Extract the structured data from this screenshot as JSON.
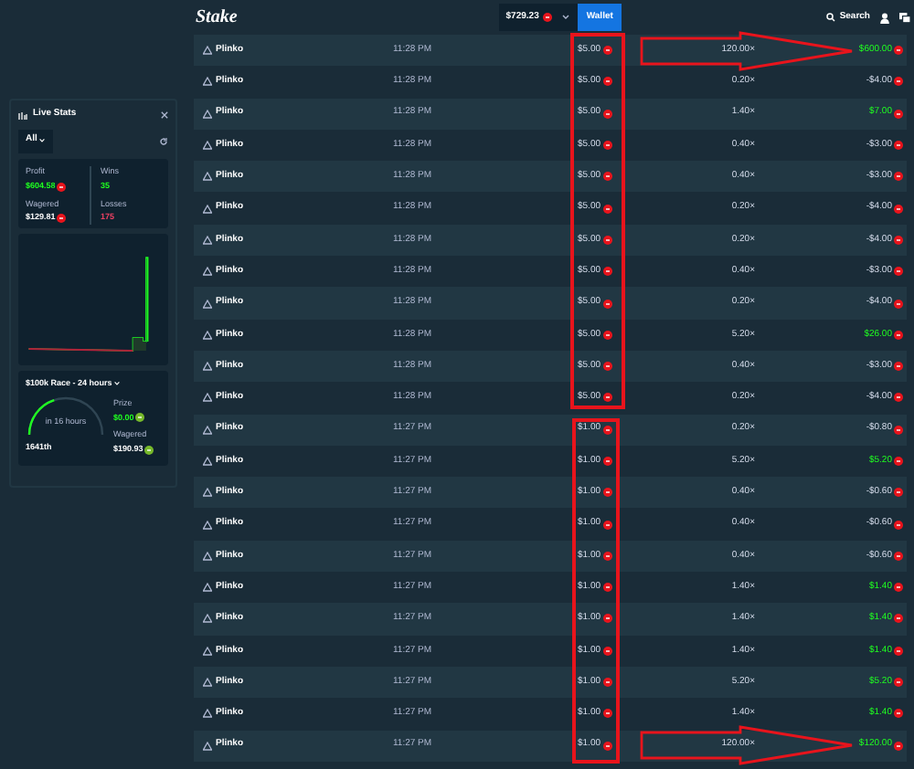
{
  "header": {
    "logo": "Stake",
    "balance": "$729.23",
    "wallet_button": "Wallet",
    "search": "Search"
  },
  "live_stats": {
    "title": "Live Stats",
    "filter": "All",
    "profit_label": "Profit",
    "profit": "$604.58",
    "wins_label": "Wins",
    "wins": "35",
    "wagered_label": "Wagered",
    "wagered": "$129.81",
    "losses_label": "Losses",
    "losses": "175",
    "race": {
      "title": "$100k Race - 24 hours",
      "timer": "in 16 hours",
      "rank": "1641th",
      "prize_label": "Prize",
      "prize": "$0.00",
      "wagered_label": "Wagered",
      "wagered": "$190.93"
    }
  },
  "bets": [
    {
      "game": "Plinko",
      "time": "11:28 PM",
      "bet": "$5.00",
      "multiplier": "120.00×",
      "payout": "$600.00",
      "win": true
    },
    {
      "game": "Plinko",
      "time": "11:28 PM",
      "bet": "$5.00",
      "multiplier": "0.20×",
      "payout": "-$4.00",
      "win": false
    },
    {
      "game": "Plinko",
      "time": "11:28 PM",
      "bet": "$5.00",
      "multiplier": "1.40×",
      "payout": "$7.00",
      "win": true
    },
    {
      "game": "Plinko",
      "time": "11:28 PM",
      "bet": "$5.00",
      "multiplier": "0.40×",
      "payout": "-$3.00",
      "win": false
    },
    {
      "game": "Plinko",
      "time": "11:28 PM",
      "bet": "$5.00",
      "multiplier": "0.40×",
      "payout": "-$3.00",
      "win": false
    },
    {
      "game": "Plinko",
      "time": "11:28 PM",
      "bet": "$5.00",
      "multiplier": "0.20×",
      "payout": "-$4.00",
      "win": false
    },
    {
      "game": "Plinko",
      "time": "11:28 PM",
      "bet": "$5.00",
      "multiplier": "0.20×",
      "payout": "-$4.00",
      "win": false
    },
    {
      "game": "Plinko",
      "time": "11:28 PM",
      "bet": "$5.00",
      "multiplier": "0.40×",
      "payout": "-$3.00",
      "win": false
    },
    {
      "game": "Plinko",
      "time": "11:28 PM",
      "bet": "$5.00",
      "multiplier": "0.20×",
      "payout": "-$4.00",
      "win": false
    },
    {
      "game": "Plinko",
      "time": "11:28 PM",
      "bet": "$5.00",
      "multiplier": "5.20×",
      "payout": "$26.00",
      "win": true
    },
    {
      "game": "Plinko",
      "time": "11:28 PM",
      "bet": "$5.00",
      "multiplier": "0.40×",
      "payout": "-$3.00",
      "win": false
    },
    {
      "game": "Plinko",
      "time": "11:28 PM",
      "bet": "$5.00",
      "multiplier": "0.20×",
      "payout": "-$4.00",
      "win": false
    },
    {
      "game": "Plinko",
      "time": "11:27 PM",
      "bet": "$1.00",
      "multiplier": "0.20×",
      "payout": "-$0.80",
      "win": false
    },
    {
      "game": "Plinko",
      "time": "11:27 PM",
      "bet": "$1.00",
      "multiplier": "5.20×",
      "payout": "$5.20",
      "win": true
    },
    {
      "game": "Plinko",
      "time": "11:27 PM",
      "bet": "$1.00",
      "multiplier": "0.40×",
      "payout": "-$0.60",
      "win": false
    },
    {
      "game": "Plinko",
      "time": "11:27 PM",
      "bet": "$1.00",
      "multiplier": "0.40×",
      "payout": "-$0.60",
      "win": false
    },
    {
      "game": "Plinko",
      "time": "11:27 PM",
      "bet": "$1.00",
      "multiplier": "0.40×",
      "payout": "-$0.60",
      "win": false
    },
    {
      "game": "Plinko",
      "time": "11:27 PM",
      "bet": "$1.00",
      "multiplier": "1.40×",
      "payout": "$1.40",
      "win": true
    },
    {
      "game": "Plinko",
      "time": "11:27 PM",
      "bet": "$1.00",
      "multiplier": "1.40×",
      "payout": "$1.40",
      "win": true
    },
    {
      "game": "Plinko",
      "time": "11:27 PM",
      "bet": "$1.00",
      "multiplier": "1.40×",
      "payout": "$1.40",
      "win": true
    },
    {
      "game": "Plinko",
      "time": "11:27 PM",
      "bet": "$1.00",
      "multiplier": "5.20×",
      "payout": "$5.20",
      "win": true
    },
    {
      "game": "Plinko",
      "time": "11:27 PM",
      "bet": "$1.00",
      "multiplier": "1.40×",
      "payout": "$1.40",
      "win": true
    },
    {
      "game": "Plinko",
      "time": "11:27 PM",
      "bet": "$1.00",
      "multiplier": "120.00×",
      "payout": "$120.00",
      "win": true
    }
  ]
}
